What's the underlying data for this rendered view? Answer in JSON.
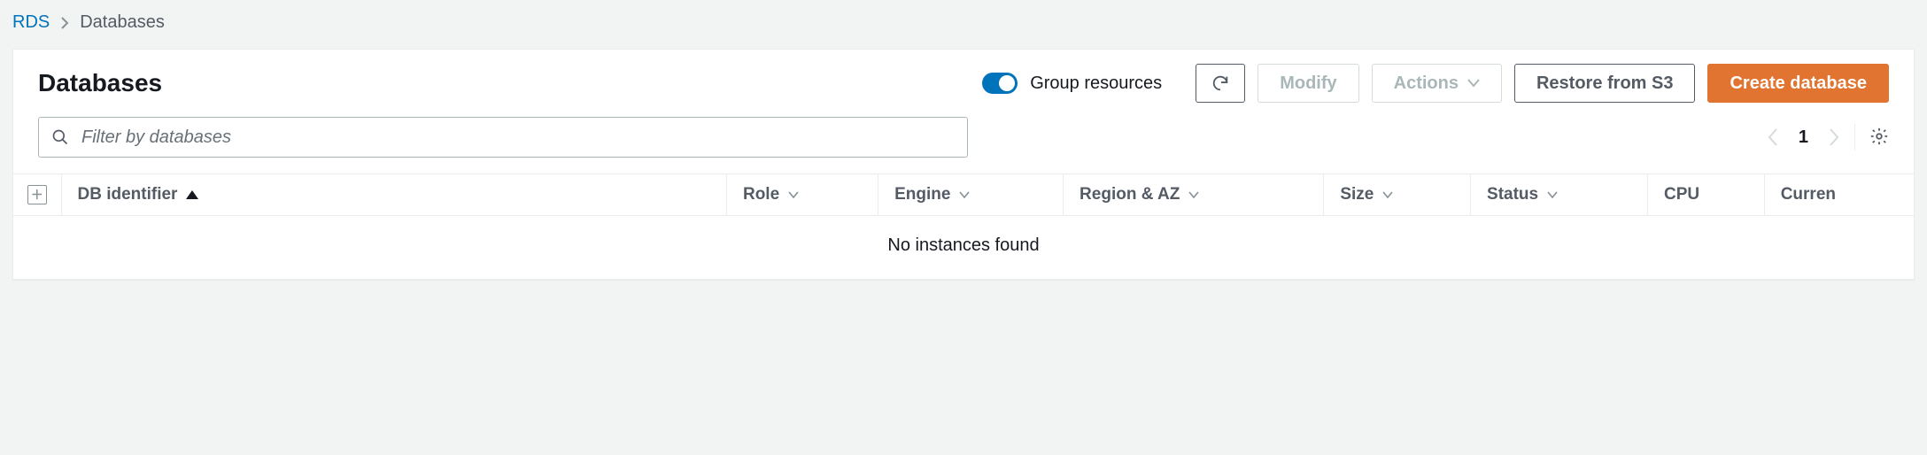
{
  "breadcrumb": {
    "root": "RDS",
    "current": "Databases"
  },
  "title": "Databases",
  "toggle": {
    "label": "Group resources",
    "on": true
  },
  "actions": {
    "modify": "Modify",
    "actions": "Actions",
    "restore": "Restore from S3",
    "create": "Create database"
  },
  "filter": {
    "placeholder": "Filter by databases"
  },
  "pager": {
    "page": "1"
  },
  "columns": {
    "db_identifier": "DB identifier",
    "role": "Role",
    "engine": "Engine",
    "region_az": "Region & AZ",
    "size": "Size",
    "status": "Status",
    "cpu": "CPU",
    "current": "Curren"
  },
  "empty_message": "No instances found",
  "rows": []
}
